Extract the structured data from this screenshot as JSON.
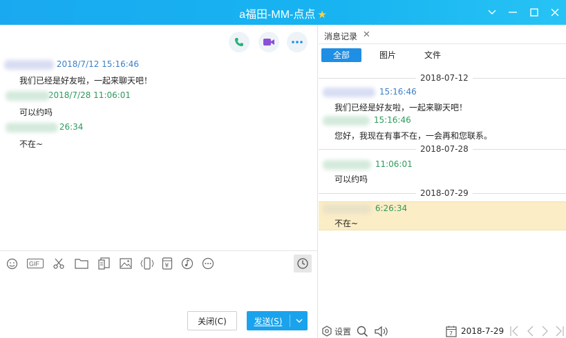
{
  "window": {
    "title": "a福田-MM-点点",
    "title_star": "★"
  },
  "chat": {
    "messages": [
      {
        "time": "2018/7/12 15:16:46",
        "body": "我们已经是好友啦，一起来聊天吧！",
        "color": "#3c7fc5"
      },
      {
        "time": "2018/7/28 11:06:01",
        "body": "可以约吗",
        "color": "#2c9a5a"
      },
      {
        "time": "26:34",
        "body": "不在~",
        "color": "#2c9a5a"
      }
    ],
    "toolbar_icons": [
      "smile-icon",
      "gif-icon",
      "scissors-icon",
      "folder-icon",
      "doc-icon",
      "image-icon",
      "shake-icon",
      "red-packet-icon",
      "music-icon",
      "more-icon"
    ],
    "gif_label": "GIF",
    "red_packet_glyph": "¥",
    "close_label": "关闭(C)",
    "send_label": "发送(S)"
  },
  "history": {
    "tab_label": "消息记录",
    "filters": [
      "全部",
      "图片",
      "文件"
    ],
    "dates": [
      "2018-07-12",
      "2018-07-28",
      "2018-07-29"
    ],
    "messages": [
      {
        "sender_suffix": "15:16:46",
        "body": "我们已经是好友啦，一起来聊天吧！",
        "color": "#3c7fc5"
      },
      {
        "sender_suffix": "15:16:46",
        "body": "您好，我现在有事不在，一会再和您联系。",
        "color": "#2c9a5a"
      },
      {
        "sender_suffix": "11:06:01",
        "body": "可以约吗",
        "color": "#2c9a5a"
      },
      {
        "sender_suffix": "6:26:34",
        "body": "不在~",
        "color": "#2c9a5a"
      }
    ],
    "footer": {
      "settings_label": "设置",
      "calendar_day": "7",
      "date": "2018-7-29"
    }
  },
  "colors": {
    "accent": "#1aa3ec",
    "title_bar": "#17b4f1",
    "highlight": "#fbedc6",
    "sender_blue": "#3c7fc5",
    "sender_green": "#2c9a5a"
  }
}
